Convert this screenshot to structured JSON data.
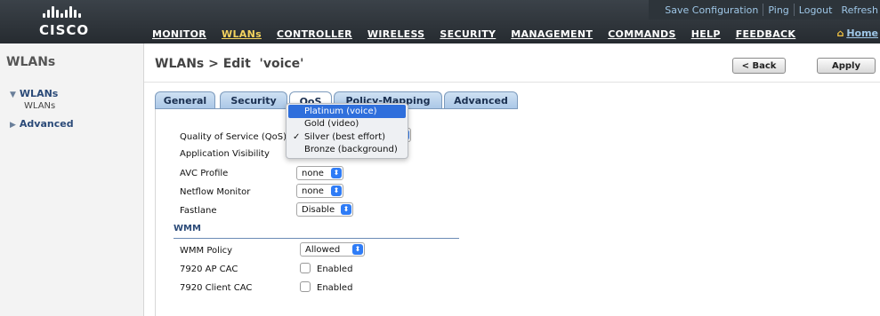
{
  "logo": {
    "text": "cisco"
  },
  "utility_links": [
    {
      "label": "Save Configuration"
    },
    {
      "label": "Ping"
    },
    {
      "label": "Logout"
    },
    {
      "label": "Refresh"
    }
  ],
  "main_nav": [
    {
      "label": "MONITOR",
      "active": false
    },
    {
      "label": "WLANs",
      "active": true
    },
    {
      "label": "CONTROLLER",
      "active": false
    },
    {
      "label": "WIRELESS",
      "active": false
    },
    {
      "label": "SECURITY",
      "active": false
    },
    {
      "label": "MANAGEMENT",
      "active": false
    },
    {
      "label": "COMMANDS",
      "active": false
    },
    {
      "label": "HELP",
      "active": false
    },
    {
      "label": "FEEDBACK",
      "active": false
    }
  ],
  "home": {
    "label": "Home"
  },
  "sidebar": {
    "title": "WLANs",
    "group_label": "WLANs",
    "sub_item": "WLANs",
    "advanced_label": "Advanced"
  },
  "page": {
    "title": "WLANs > Edit  'voice'",
    "back_label": "< Back",
    "apply_label": "Apply"
  },
  "tabs": [
    {
      "label": "General"
    },
    {
      "label": "Security"
    },
    {
      "label": "QoS"
    },
    {
      "label": "Policy-Mapping"
    },
    {
      "label": "Advanced"
    }
  ],
  "form": {
    "qos_label": "Quality of Service (QoS)",
    "app_visibility_label": "Application Visibility",
    "avc_profile_label": "AVC Profile",
    "avc_profile_value": "none",
    "netflow_label": "Netflow Monitor",
    "netflow_value": "none",
    "fastlane_label": "Fastlane",
    "fastlane_value": "Disable",
    "wmm_section": "WMM",
    "wmm_policy_label": "WMM Policy",
    "wmm_policy_value": "Allowed",
    "ap_cac_label": "7920 AP CAC",
    "ap_cac_value": "Enabled",
    "client_cac_label": "7920 Client CAC",
    "client_cac_value": "Enabled"
  },
  "qos_dropdown": {
    "options": [
      {
        "label": "Platinum (voice)",
        "highlighted": true,
        "checked": false
      },
      {
        "label": "Gold (video)",
        "highlighted": false,
        "checked": false
      },
      {
        "label": "Silver (best effort)",
        "highlighted": false,
        "checked": true
      },
      {
        "label": "Bronze (background)",
        "highlighted": false,
        "checked": false
      }
    ]
  },
  "colors": {
    "accent_nav_active": "#f4d35e",
    "tab_bg": "#a9c6e6",
    "highlight": "#2f6fdc",
    "select_arrow": "#2f7cf6"
  }
}
